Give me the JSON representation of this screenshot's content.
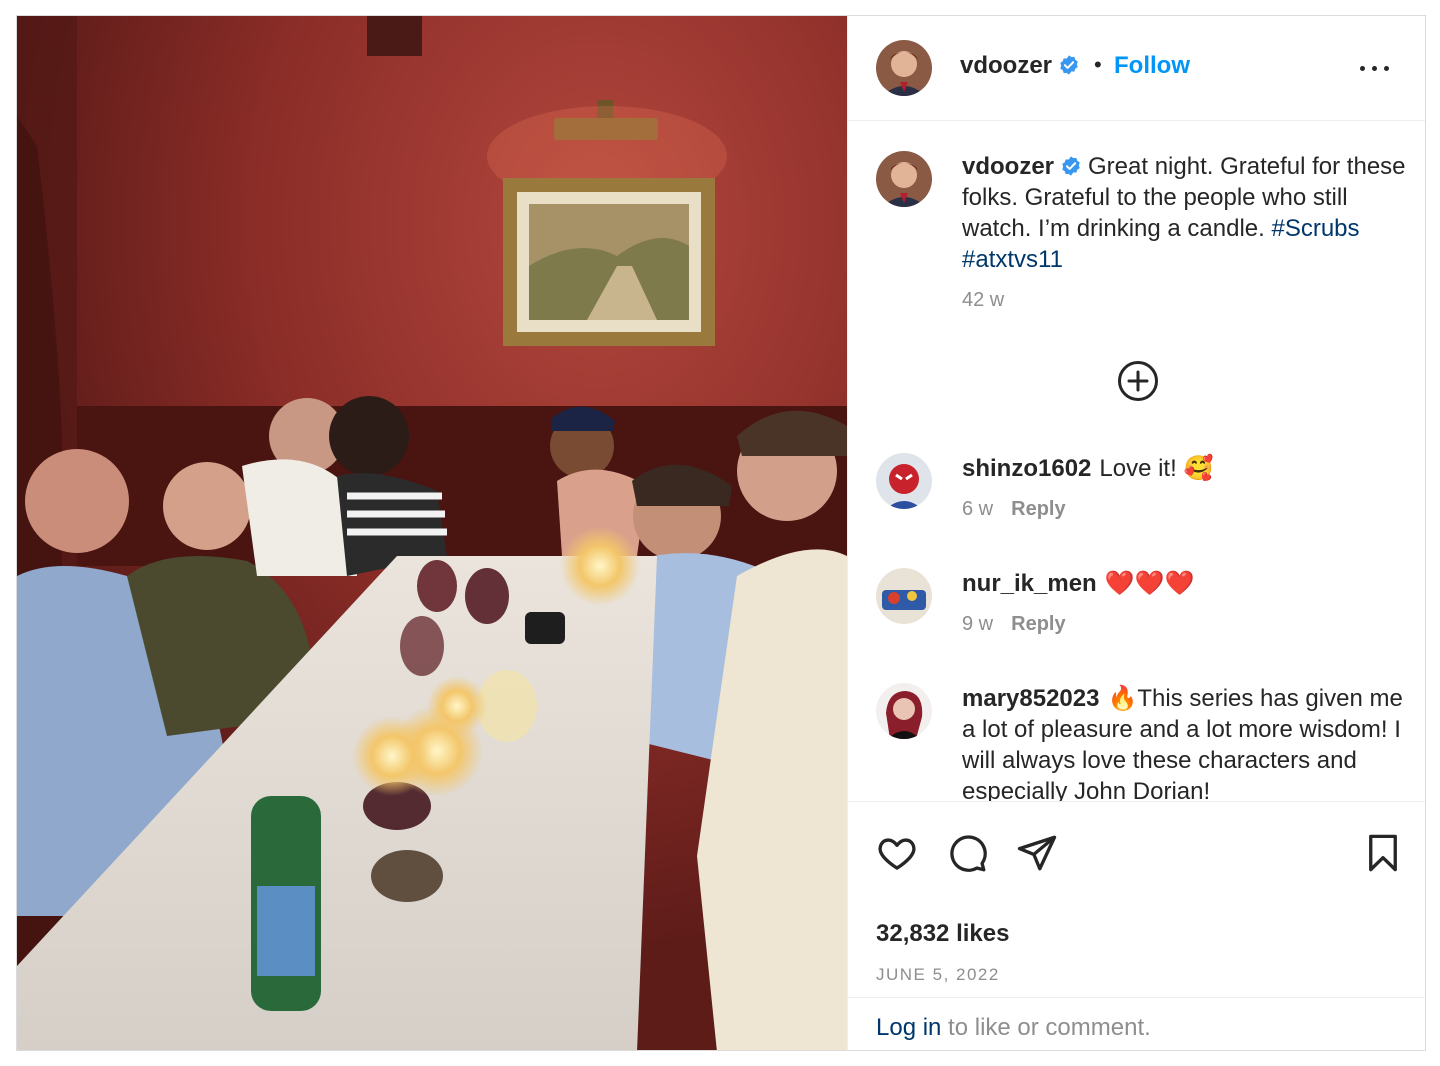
{
  "post": {
    "username": "vdoozer",
    "follow_label": "Follow",
    "separator": "•",
    "caption_text": "Great night. Grateful for these folks. Grateful to the people who still watch. I’m drinking a candle.",
    "hashtags": [
      "#Scrubs",
      "#atxtvs11"
    ],
    "caption_age": "42 w"
  },
  "comments": [
    {
      "username": "shinzo1602",
      "text": "Love it! 🥰",
      "age": "6 w",
      "reply_label": "Reply"
    },
    {
      "username": "nur_ik_men",
      "text": "❤️❤️❤️",
      "age": "9 w",
      "reply_label": "Reply"
    },
    {
      "username": "mary852023",
      "text": "🔥This series has given me a lot of pleasure and a lot more wisdom! I will always love these characters and especially John Dorian!"
    }
  ],
  "stats": {
    "likes": "32,832 likes",
    "date": "JUNE 5, 2022"
  },
  "login": {
    "link": "Log in",
    "text": " to like or comment."
  },
  "icons": {
    "verified": "verified-badge-icon",
    "more": "more-options-icon",
    "load_more": "plus-circle-icon",
    "like": "heart-icon",
    "comment": "comment-bubble-icon",
    "share": "paper-plane-icon",
    "save": "bookmark-icon"
  },
  "colors": {
    "accent": "#0095f6",
    "hashtag": "#00376b",
    "verified": "#3897f0",
    "muted": "#8e8e8e",
    "text": "#262626"
  }
}
